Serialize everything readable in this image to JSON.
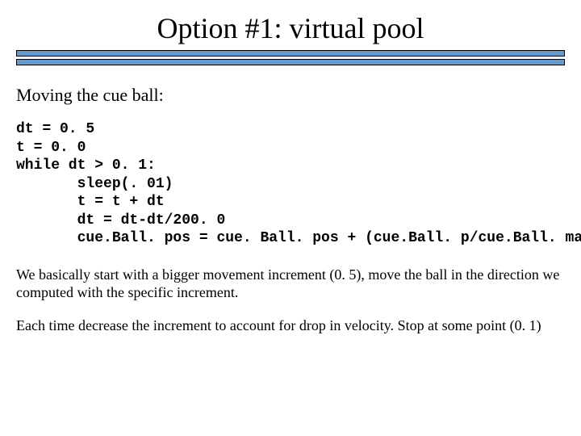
{
  "title": "Option #1:   virtual pool",
  "subheading": "Moving the cue ball:",
  "code": "dt = 0. 5\nt = 0. 0\nwhile dt > 0. 1:\n       sleep(. 01)\n       t = t + dt\n       dt = dt-dt/200. 0\n       cue.Ball. pos = cue. Ball. pos + (cue.Ball. p/cue.Ball. mass)*dt",
  "para1": "We basically start with a bigger movement increment (0. 5), move the ball in the direction we computed with the specific increment.",
  "para2": "Each time decrease the increment to account for drop in velocity. Stop at some point (0. 1)"
}
